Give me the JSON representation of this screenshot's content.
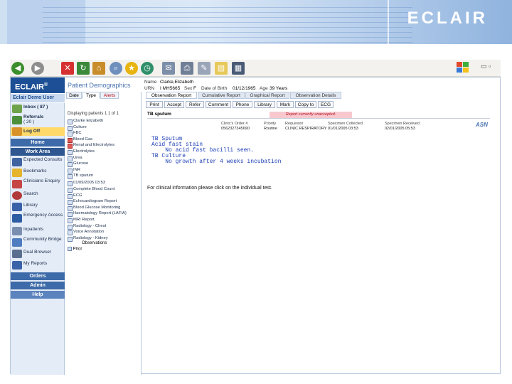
{
  "banner": {
    "brand": "ECLAIR"
  },
  "toolbar": {
    "icons": [
      "back-icon",
      "forward-icon",
      "stop-icon",
      "refresh-icon",
      "home-icon",
      "search-icon",
      "favorites-icon",
      "history-icon",
      "mail-icon",
      "print-icon",
      "edit-icon",
      "discuss-icon",
      "research-icon"
    ]
  },
  "app": {
    "logo": "ECLAIR",
    "logo_mark": "®",
    "demo_user": "Eclair Demo User",
    "header": "Patient Demographics",
    "patient": {
      "name_label": "Name",
      "name_value": "Clarke,Elizabeth",
      "urn_label": "URN",
      "urn_value": "I MH5665",
      "sex_label": "Sex",
      "sex_value": "F",
      "dob_label": "Date of Birth",
      "dob_value": "01/12/1965",
      "age_label": "Age",
      "age_value": "39 Years"
    }
  },
  "nav": {
    "inbox": "Inbox ( 87 )",
    "referrals": "Referrals",
    "referrals_count": "( 20 )",
    "logoff": "Log Off",
    "home": "Home",
    "work_area": "Work Area",
    "expected_consults": "Expected Consults",
    "bookmarks": "Bookmarks",
    "clinicians_enquiry": "Clinicians Enquiry",
    "search": "Search",
    "library": "Library",
    "emergency_access": "Emergency Access",
    "inpatients": "Inpatients",
    "community_bridge": "Community Bridge",
    "dual_browser": "Dual Browser",
    "my_reports": "My Reports",
    "orders": "Orders",
    "admin": "Admin",
    "help": "Help"
  },
  "list": {
    "tabs": [
      "Date",
      "Type",
      "Alerts"
    ],
    "active_tab": "Type",
    "header": "Displaying patients 1 1 of 1",
    "items": [
      "Clarke Elizabeth",
      "Culture",
      "FBC",
      "Blood Gas",
      "Renal and Electrolytes",
      "Electrolytes",
      "Urea",
      "Glucose",
      "INR",
      "TB sputum",
      "01/09/2005 03:53",
      "Complete Blood Count",
      "ECG",
      "Echocardiogram Report",
      "Blood Glucose Monitoring",
      "Haematology Report (LAFIA)",
      "MRI Report",
      "Radiology - Chest",
      "Voice Annotation",
      "Radiology - Kidney"
    ],
    "red_items": [
      3,
      4
    ],
    "observations_label": "Observations",
    "prior_label": "Prior"
  },
  "report": {
    "tabs": [
      "Observation Report",
      "Cumulative Report",
      "Graphical Report",
      "Observation Details"
    ],
    "active_tab": "Observation Report",
    "buttons": [
      "Print",
      "Accept",
      "Refer",
      "Comment",
      "Phone",
      "Library",
      "Mark",
      "Copy to",
      "ECG"
    ],
    "title": "TB sputum",
    "warning": "Report currently unaccepted.",
    "meta_headers": [
      "Clinic's Order #",
      "Priority",
      "Requestor",
      "Specimen Collected",
      "Specimen Received"
    ],
    "meta_values": [
      "0562327345690",
      "Routine",
      "CLINIC RESPIRATORY",
      "01/01/2005 03:53",
      "02/01/2005 05:53"
    ],
    "asn": "ASN",
    "lines": [
      "TB Sputum",
      "Acid fast stain",
      "    No acid fast bacilli seen.",
      "TB Culture",
      "    No growth after 4 weeks incubation"
    ],
    "clinical": "For clinical information please click on the individual test."
  }
}
